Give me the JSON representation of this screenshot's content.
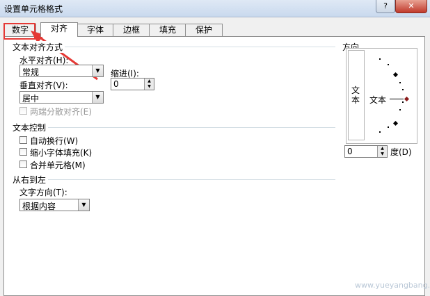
{
  "window": {
    "title": "设置单元格格式",
    "help_label": "?",
    "close_label": "✕"
  },
  "tabs": [
    {
      "label": "数字"
    },
    {
      "label": "对齐"
    },
    {
      "label": "字体"
    },
    {
      "label": "边框"
    },
    {
      "label": "填充"
    },
    {
      "label": "保护"
    }
  ],
  "text_alignment": {
    "group_title": "文本对齐方式",
    "horizontal_label": "水平对齐(H):",
    "horizontal_value": "常规",
    "indent_label": "缩进(I):",
    "indent_value": "0",
    "vertical_label": "垂直对齐(V):",
    "vertical_value": "居中",
    "justify_distributed_label": "两端分散对齐(E)"
  },
  "text_control": {
    "group_title": "文本控制",
    "wrap_text_label": "自动换行(W)",
    "shrink_to_fit_label": "缩小字体填充(K)",
    "merge_cells_label": "合并单元格(M)"
  },
  "rtl": {
    "group_title": "从右到左",
    "direction_label": "文字方向(T):",
    "direction_value": "根据内容"
  },
  "orientation": {
    "group_title": "方向",
    "vertical_text": "文本",
    "dial_text": "文本",
    "degrees_value": "0",
    "degrees_label": "度(D)"
  },
  "watermark": {
    "text": "www.yueyangbang.com"
  },
  "colors": {
    "highlight": "#e53935",
    "pointer": "#8b1a1a"
  }
}
